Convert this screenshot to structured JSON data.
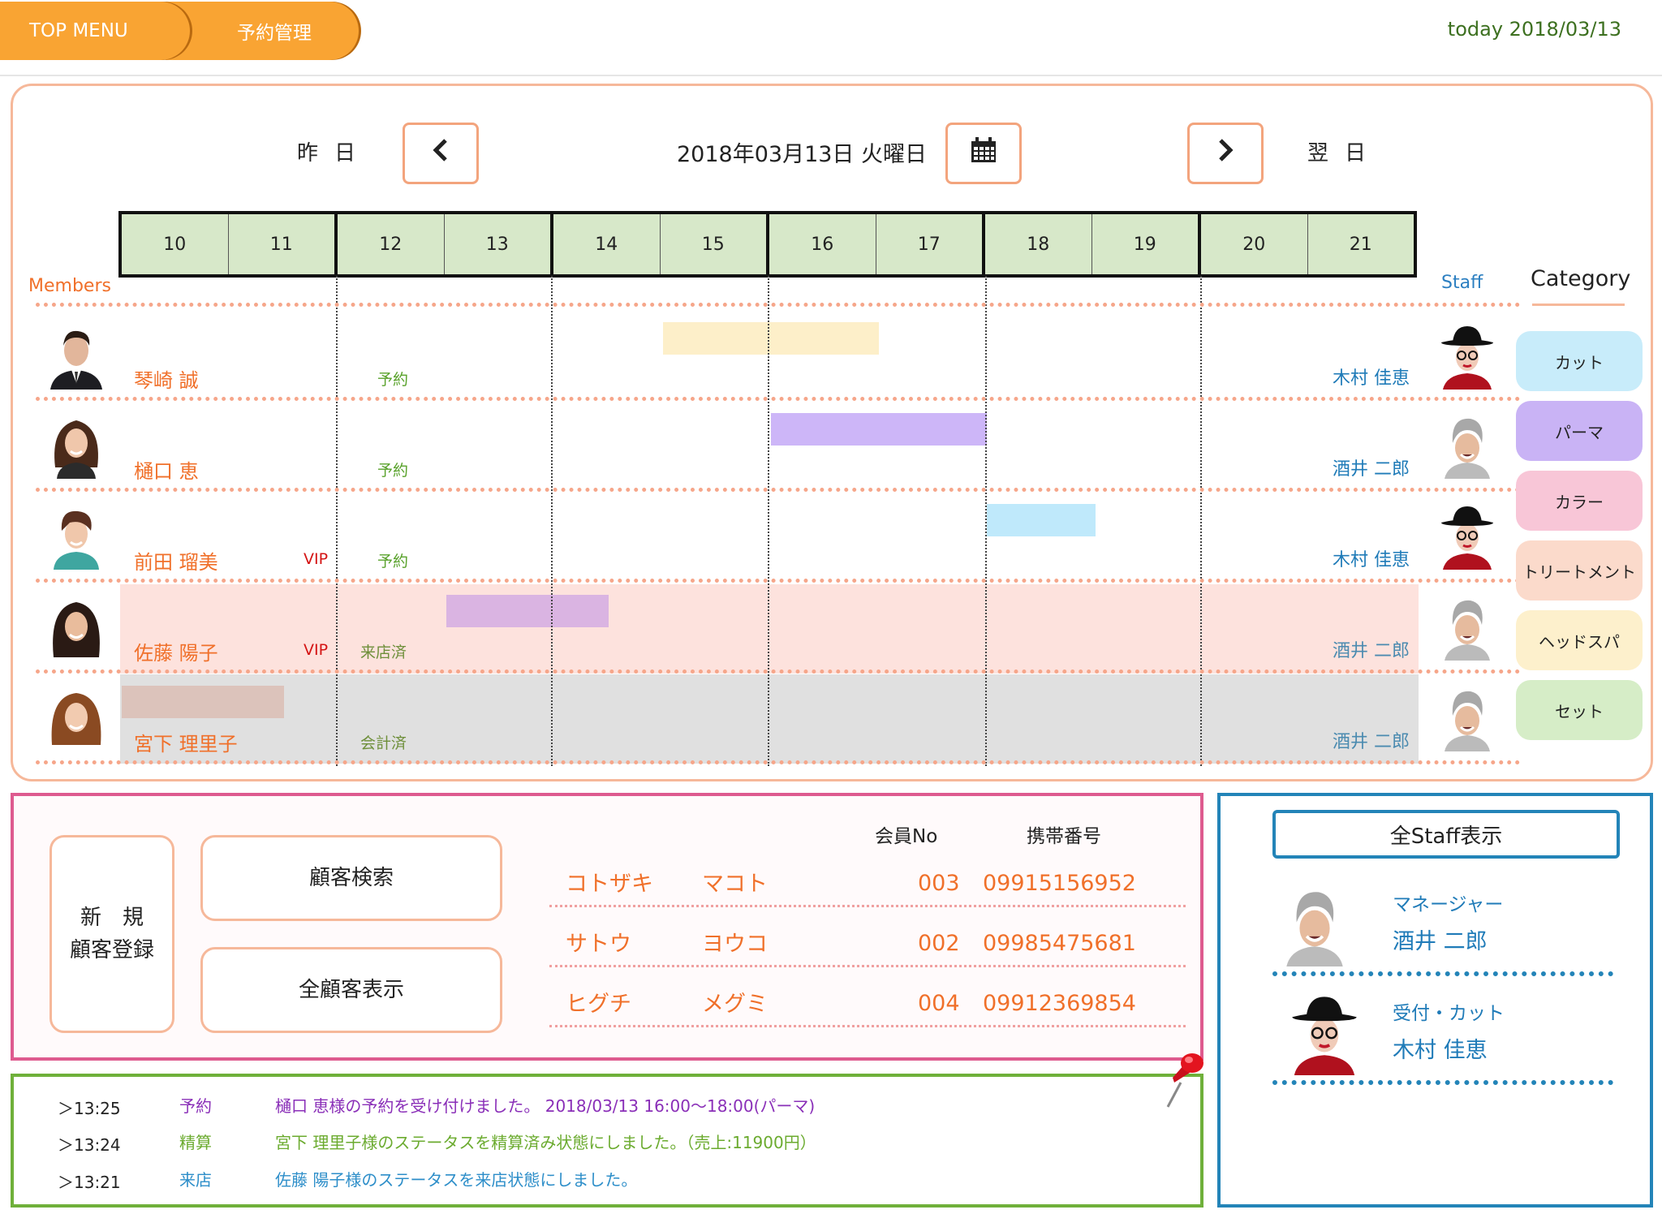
{
  "header": {
    "top_menu": "TOP MENU",
    "section": "予約管理",
    "today": "today 2018/03/13"
  },
  "schedule": {
    "prev_label": "昨日",
    "next_label": "翌日",
    "date_label": "2018年03月13日 火曜日",
    "prev_icon": "chevron-left-icon",
    "next_icon": "chevron-right-icon",
    "calendar_icon": "calendar-icon",
    "hours": [
      "10",
      "11",
      "12",
      "13",
      "14",
      "15",
      "16",
      "17",
      "18",
      "19",
      "20",
      "21"
    ],
    "members_label": "Members",
    "staff_label": "Staff",
    "rows": [
      {
        "name": "琴崎 誠",
        "vip": "",
        "status": "予約",
        "staff": "木村 佳恵",
        "bar_start": 15,
        "bar_end": 17,
        "bar_color": "#fdefc9",
        "row_state": "none"
      },
      {
        "name": "樋口 恵",
        "vip": "",
        "status": "予約",
        "staff": "酒井 二郎",
        "bar_start": 16,
        "bar_end": 18,
        "bar_color": "#cdb6f8",
        "row_state": "none"
      },
      {
        "name": "前田 瑠美",
        "vip": "VIP",
        "status": "予約",
        "staff": "木村 佳恵",
        "bar_start": 18,
        "bar_end": 19,
        "bar_color": "#bfe9fb",
        "row_state": "none"
      },
      {
        "name": "佐藤 陽子",
        "vip": "VIP",
        "status": "来店済",
        "staff": "酒井 二郎",
        "bar_start": 13,
        "bar_end": 14.5,
        "bar_color": "#dab4e2",
        "row_state": "visited"
      },
      {
        "name": "宮下 理里子",
        "vip": "",
        "status": "会計済",
        "staff": "酒井 二郎",
        "bar_start": 10,
        "bar_end": 11.5,
        "bar_color": "#dcc3bb",
        "row_state": "paid"
      }
    ]
  },
  "category": {
    "title": "Category",
    "items": [
      {
        "label": "カット",
        "color": "#c8ecfa"
      },
      {
        "label": "パーマ",
        "color": "#c9b3f5"
      },
      {
        "label": "カラー",
        "color": "#f8c6d7"
      },
      {
        "label": "トリートメント",
        "color": "#fbdacb"
      },
      {
        "label": "ヘッドスパ",
        "color": "#fdf0cc"
      },
      {
        "label": "セット",
        "color": "#d6edc7"
      }
    ]
  },
  "customers": {
    "new_button": [
      "新　規",
      "顧客登録"
    ],
    "search_button": "顧客検索",
    "all_button": "全顧客表示",
    "col_no": "会員No",
    "col_tel": "携帯番号",
    "list": [
      {
        "last": "コトザキ",
        "first": "マコト",
        "no": "003",
        "tel": "09915156952"
      },
      {
        "last": "サトウ",
        "first": "ヨウコ",
        "no": "002",
        "tel": "09985475681"
      },
      {
        "last": "ヒグチ",
        "first": "メグミ",
        "no": "004",
        "tel": "09912369854"
      }
    ]
  },
  "log": [
    {
      "time": "＞13:25",
      "type": "予約",
      "message": "樋口 恵様の予約を受け付けました。 2018/03/13 16:00〜18:00(パーマ)",
      "color": "#8a2fb8"
    },
    {
      "time": "＞13:24",
      "type": "精算",
      "message": "宮下 理里子様のステータスを精算済み状態にしました。（売上:11900円）",
      "color": "#6bab2f"
    },
    {
      "time": "＞13:21",
      "type": "来店",
      "message": "佐藤 陽子様のステータスを来店状態にしました。",
      "color": "#2d8ec9"
    }
  ],
  "staff_panel": {
    "all_button": "全Staff表示",
    "members": [
      {
        "role": "マネージャー",
        "name": "酒井 二郎"
      },
      {
        "role": "受付・カット",
        "name": "木村 佳恵"
      }
    ]
  }
}
